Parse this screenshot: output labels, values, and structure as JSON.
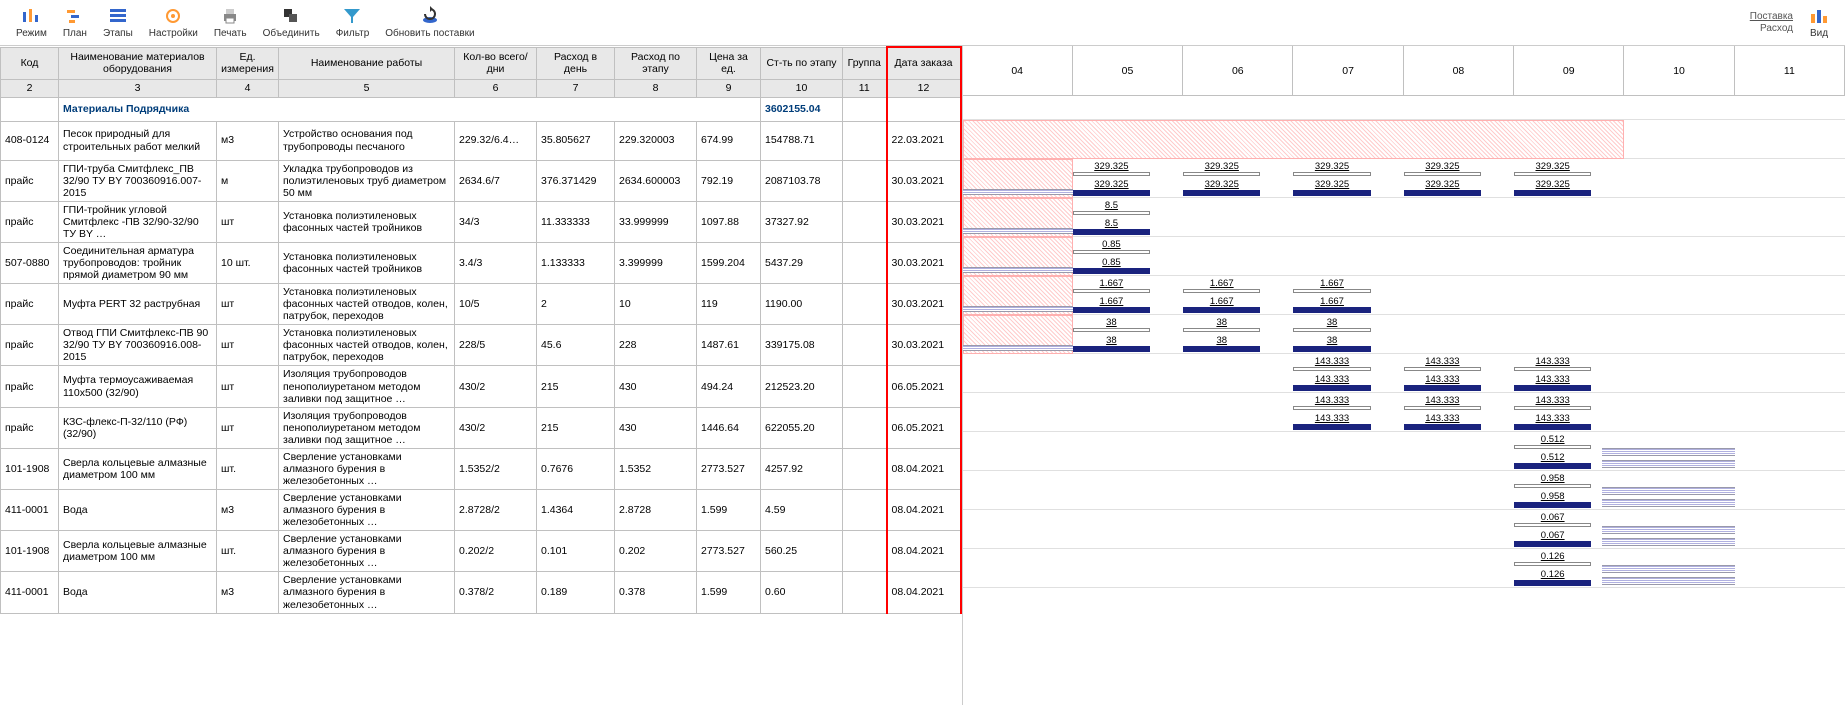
{
  "toolbar": {
    "mode": "Режим",
    "plan": "План",
    "stages": "Этапы",
    "settings": "Настройки",
    "print": "Печать",
    "merge": "Объединить",
    "filter": "Фильтр",
    "refresh": "Обновить поставки",
    "supply": "Поставка",
    "consumption": "Расход",
    "view": "Вид"
  },
  "columns": {
    "code": "Код",
    "name": "Наименование материалов оборудования",
    "unit": "Ед. измерения",
    "work": "Наименование работы",
    "qty": "Кол-во всего/ дни",
    "per_day": "Расход в день",
    "per_stage": "Расход по этапу",
    "price": "Цена за ед.",
    "cost": "Ст-ть по этапу",
    "group": "Группа",
    "order_date": "Дата заказа"
  },
  "col_nums": [
    "2",
    "3",
    "4",
    "5",
    "6",
    "7",
    "8",
    "9",
    "10",
    "11",
    "12"
  ],
  "gantt_cols": [
    "04",
    "05",
    "06",
    "07",
    "08",
    "09",
    "10",
    "11"
  ],
  "group_row": {
    "title": "Материалы Подрядчика",
    "total": "3602155.04"
  },
  "rows": [
    {
      "code": "408-0124",
      "name": "Песок природный для строительных работ мелкий",
      "unit": "м3",
      "work": "Устройство основания под трубопроводы песчаного",
      "qty": "229.32/6.4…",
      "per_day": "35.805627",
      "per_stage": "229.320003",
      "price": "674.99",
      "cost": "154788.71",
      "date": "22.03.2021",
      "bars": null,
      "hatch": "red_full"
    },
    {
      "code": "прайс",
      "name": "ГПИ-труба Смитфлекс_ПВ 32/90 ТУ BY 700360916.007-2015",
      "unit": "м",
      "work": "Укладка трубопроводов из полиэтиленовых труб диаметром 50 мм",
      "qty": "2634.6/7",
      "per_day": "376.371429",
      "per_stage": "2634.600003",
      "price": "792.19",
      "cost": "2087103.78",
      "date": "30.03.2021",
      "bars": {
        "start": 1,
        "span": 5,
        "val": "329.325"
      },
      "hatch": "both"
    },
    {
      "code": "прайс",
      "name": "ГПИ-тройник угловой Смитфлекс -ПВ 32/90-32/90 ТУ BY …",
      "unit": "шт",
      "work": "Установка полиэтиленовых фасонных частей тройников",
      "qty": "34/3",
      "per_day": "11.333333",
      "per_stage": "33.999999",
      "price": "1097.88",
      "cost": "37327.92",
      "date": "30.03.2021",
      "bars": {
        "start": 1,
        "span": 1,
        "val": "8.5"
      },
      "hatch": "both"
    },
    {
      "code": "507-0880",
      "name": "Соединительная арматура трубопроводов: тройник прямой диаметром 90 мм",
      "unit": "10 шт.",
      "work": "Установка полиэтиленовых фасонных частей тройников",
      "qty": "3.4/3",
      "per_day": "1.133333",
      "per_stage": "3.399999",
      "price": "1599.204",
      "cost": "5437.29",
      "date": "30.03.2021",
      "bars": {
        "start": 1,
        "span": 1,
        "val": "0.85"
      },
      "hatch": "both"
    },
    {
      "code": "прайс",
      "name": "Муфта PERT 32 раструбная",
      "unit": "шт",
      "work": "Установка полиэтиленовых фасонных частей отводов, колен, патрубок, переходов",
      "qty": "10/5",
      "per_day": "2",
      "per_stage": "10",
      "price": "119",
      "cost": "1190.00",
      "date": "30.03.2021",
      "bars": {
        "start": 1,
        "span": 3,
        "val": "1.667"
      },
      "hatch": "both"
    },
    {
      "code": "прайс",
      "name": "Отвод ГПИ Смитфлекс-ПВ 90 32/90 ТУ BY 700360916.008-2015",
      "unit": "шт",
      "work": "Установка полиэтиленовых фасонных частей отводов, колен, патрубок, переходов",
      "qty": "228/5",
      "per_day": "45.6",
      "per_stage": "228",
      "price": "1487.61",
      "cost": "339175.08",
      "date": "30.03.2021",
      "bars": {
        "start": 1,
        "span": 3,
        "val": "38"
      },
      "hatch": "both"
    },
    {
      "code": "прайс",
      "name": "Муфта термоусаживаемая 110х500 (32/90)",
      "unit": "шт",
      "work": "Изоляция трубопроводов пенополиуретаном методом заливки под защитное …",
      "qty": "430/2",
      "per_day": "215",
      "per_stage": "430",
      "price": "494.24",
      "cost": "212523.20",
      "date": "06.05.2021",
      "bars": {
        "start": 3,
        "span": 3,
        "val": "143.333"
      },
      "hatch": "none"
    },
    {
      "code": "прайс",
      "name": "КЗС-флекс-П-32/110 (РФ) (32/90)",
      "unit": "шт",
      "work": "Изоляция трубопроводов пенополиуретаном методом заливки под защитное …",
      "qty": "430/2",
      "per_day": "215",
      "per_stage": "430",
      "price": "1446.64",
      "cost": "622055.20",
      "date": "06.05.2021",
      "bars": {
        "start": 3,
        "span": 3,
        "val": "143.333"
      },
      "hatch": "none"
    },
    {
      "code": "101-1908",
      "name": "Сверла кольцевые алмазные диаметром 100 мм",
      "unit": "шт.",
      "work": "Сверление установками алмазного бурения в железобетонных …",
      "qty": "1.5352/2",
      "per_day": "0.7676",
      "per_stage": "1.5352",
      "price": "2773.527",
      "cost": "4257.92",
      "date": "08.04.2021",
      "bars": {
        "start": 5,
        "span": 1,
        "val": "0.512"
      },
      "hatch": "blue_tail"
    },
    {
      "code": "411-0001",
      "name": "Вода",
      "unit": "м3",
      "work": "Сверление установками алмазного бурения в железобетонных …",
      "qty": "2.8728/2",
      "per_day": "1.4364",
      "per_stage": "2.8728",
      "price": "1.599",
      "cost": "4.59",
      "date": "08.04.2021",
      "bars": {
        "start": 5,
        "span": 1,
        "val": "0.958"
      },
      "hatch": "blue_tail"
    },
    {
      "code": "101-1908",
      "name": "Сверла кольцевые алмазные диаметром 100 мм",
      "unit": "шт.",
      "work": "Сверление установками алмазного бурения в железобетонных …",
      "qty": "0.202/2",
      "per_day": "0.101",
      "per_stage": "0.202",
      "price": "2773.527",
      "cost": "560.25",
      "date": "08.04.2021",
      "bars": {
        "start": 5,
        "span": 1,
        "val": "0.067"
      },
      "hatch": "blue_tail"
    },
    {
      "code": "411-0001",
      "name": "Вода",
      "unit": "м3",
      "work": "Сверление установками алмазного бурения в железобетонных …",
      "qty": "0.378/2",
      "per_day": "0.189",
      "per_stage": "0.378",
      "price": "1.599",
      "cost": "0.60",
      "date": "08.04.2021",
      "bars": {
        "start": 5,
        "span": 1,
        "val": "0.126"
      },
      "hatch": "blue_tail"
    }
  ]
}
